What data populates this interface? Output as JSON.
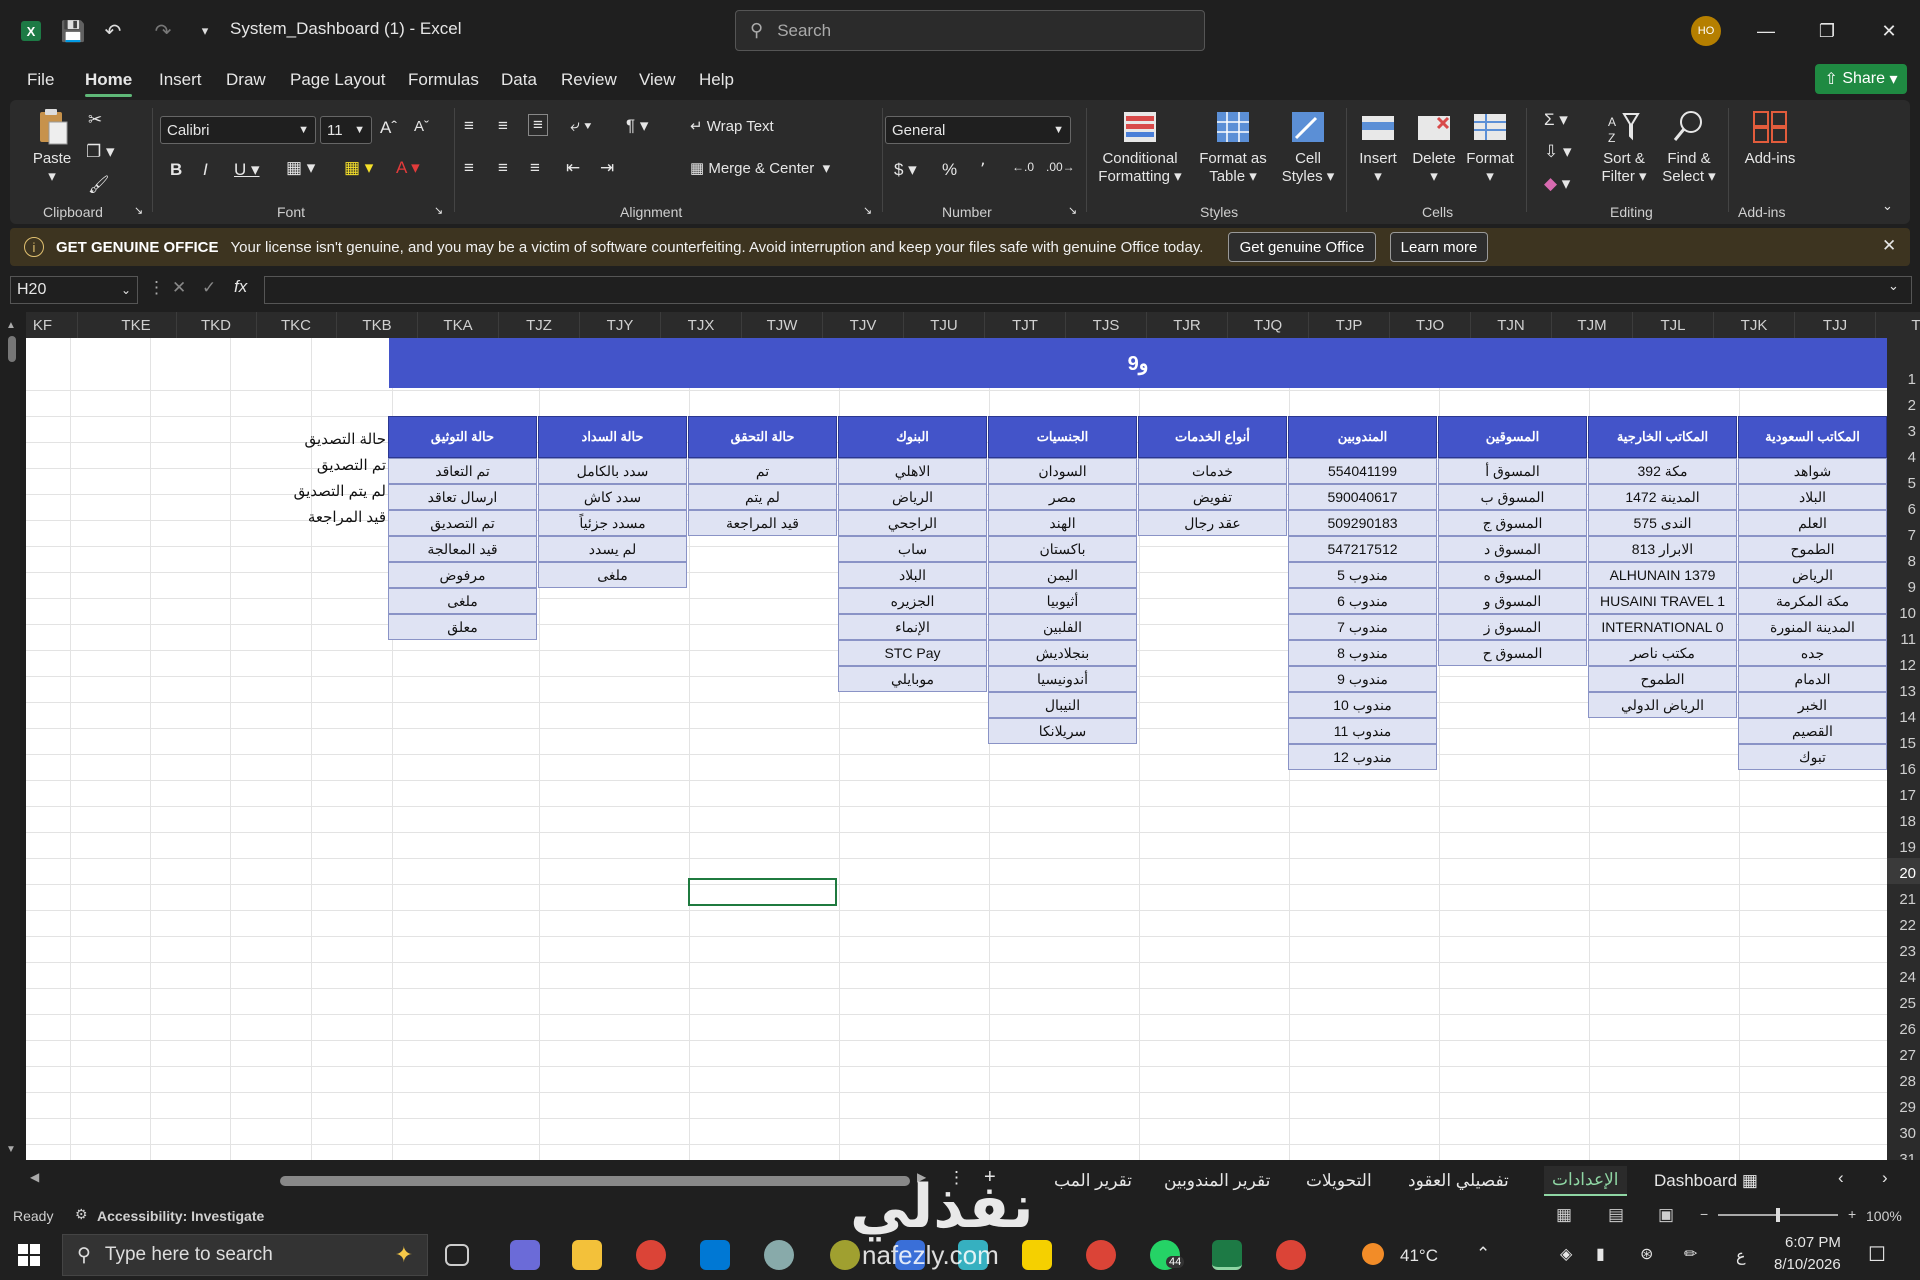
{
  "window": {
    "title": "System_Dashboard (1)  -  Excel",
    "search_placeholder": "Search",
    "avatar": "HO"
  },
  "menu": [
    "File",
    "Home",
    "Insert",
    "Draw",
    "Page Layout",
    "Formulas",
    "Data",
    "Review",
    "View",
    "Help"
  ],
  "share_label": "Share",
  "ribbon": {
    "clipboard": {
      "label": "Clipboard",
      "paste": "Paste"
    },
    "font": {
      "label": "Font",
      "name": "Calibri",
      "size": "11"
    },
    "alignment": {
      "label": "Alignment",
      "wrap": "Wrap Text",
      "merge": "Merge & Center"
    },
    "number": {
      "label": "Number",
      "format": "General"
    },
    "styles": {
      "label": "Styles",
      "conditional": "Conditional\nFormatting",
      "format_table": "Format as\nTable",
      "cell_styles": "Cell\nStyles"
    },
    "cells": {
      "label": "Cells",
      "insert": "Insert",
      "delete": "Delete",
      "format": "Format"
    },
    "editing": {
      "label": "Editing",
      "sort": "Sort &\nFilter",
      "find": "Find &\nSelect"
    },
    "addins": {
      "label": "Add-ins",
      "addins": "Add-ins"
    }
  },
  "warning": {
    "title": "GET GENUINE OFFICE",
    "message": "Your license isn't genuine, and you may be a victim of software counterfeiting. Avoid interruption and keep your files safe with genuine Office today.",
    "btn1": "Get genuine Office",
    "btn2": "Learn more"
  },
  "namebox": "H20",
  "columns": [
    "KF",
    "TKE",
    "TKD",
    "TKC",
    "TKB",
    "TKA",
    "TJZ",
    "TJY",
    "TJX",
    "TJW",
    "TJV",
    "TJU",
    "TJT",
    "TJS",
    "TJR",
    "TJQ",
    "TJP",
    "TJO",
    "TJN",
    "TJM",
    "TJL",
    "TJK",
    "TJJ",
    "T"
  ],
  "rows": [
    "1",
    "2",
    "3",
    "4",
    "5",
    "6",
    "7",
    "8",
    "9",
    "10",
    "11",
    "12",
    "13",
    "14",
    "15",
    "16",
    "17",
    "18",
    "19",
    "20",
    "21",
    "22",
    "23",
    "24",
    "25",
    "26",
    "27",
    "28",
    "29",
    "30",
    "31"
  ],
  "selected_row": "20",
  "sheet": {
    "banner": "و9",
    "side_labels": [
      "حالة التصديق",
      "تم التصديق",
      "لم يتم التصديق",
      "قيد المراجعة"
    ],
    "tables": [
      {
        "header": "المكاتب السعودية",
        "cells": [
          "شواهد",
          "البلاد",
          "العلم",
          "الطموح",
          "الرياض",
          "مكة المكرمة",
          "المدينة المنورة",
          "جده",
          "الدمام",
          "الخبر",
          "القصيم",
          "تبوك"
        ]
      },
      {
        "header": "المكاتب الخارجية",
        "cells": [
          "مكة 392",
          "المدينة 1472",
          "الندى 575",
          "الابرار 813",
          "ALHUNAIN 1379",
          "HUSAINI TRAVEL 1",
          "INTERNATIONAL 0",
          "مكتب ناصر",
          "الطموح",
          "الرياض الدولي"
        ]
      },
      {
        "header": "المسوقين",
        "cells": [
          "المسوق أ",
          "المسوق ب",
          "المسوق ج",
          "المسوق د",
          "المسوق ه",
          "المسوق و",
          "المسوق ز",
          "المسوق ح"
        ]
      },
      {
        "header": "المندوبين",
        "cells": [
          "554041199",
          "590040617",
          "509290183",
          "547217512",
          "مندوب 5",
          "مندوب 6",
          "مندوب 7",
          "مندوب 8",
          "مندوب 9",
          "مندوب 10",
          "مندوب 11",
          "مندوب 12"
        ]
      },
      {
        "header": "أنواع الخدمات",
        "cells": [
          "خدمات",
          "تفويض",
          "عقد رجال"
        ]
      },
      {
        "header": "الجنسيات",
        "cells": [
          "السودان",
          "مصر",
          "الهند",
          "باكستان",
          "اليمن",
          "أثيوبيا",
          "الفلبين",
          "بنجلاديش",
          "أندونيسيا",
          "النيبال",
          "سريلانكا"
        ]
      },
      {
        "header": "البنوك",
        "cells": [
          "الاهلي",
          "الرياض",
          "الراجحي",
          "ساب",
          "البلاد",
          "الجزيره",
          "الإنماء",
          "STC Pay",
          "موبايلي"
        ]
      },
      {
        "header": "حالة التحقق",
        "cells": [
          "تم",
          "لم يتم",
          "قيد المراجعة"
        ]
      },
      {
        "header": "حالة السداد",
        "cells": [
          "سدد بالكامل",
          "سدد كاش",
          "مسدد جزئياً",
          "لم يسدد",
          "ملغى"
        ]
      },
      {
        "header": "حالة التوثيق",
        "cells": [
          "تم التعاقد",
          "ارسال تعاقد",
          "تم التصديق",
          "قيد المعالجة",
          "مرفوض",
          "ملغى",
          "معلق"
        ]
      }
    ]
  },
  "tabs": [
    "Dashboard",
    "الإعدادات",
    "تفصيلي العقود",
    "التحويلات",
    "تقرير المندوبين",
    "تقرير المب"
  ],
  "active_tab": "الإعدادات",
  "status": {
    "ready": "Ready",
    "accessibility": "Accessibility: Investigate",
    "zoom": "100%"
  },
  "taskbar": {
    "search": "Type here to search",
    "temp": "41°C",
    "time": "6:07 PM",
    "date": "8/10/2026",
    "badge": "44",
    "lang": "ع"
  },
  "watermark": {
    "ar": "نفذلي",
    "en": "nafezly.com"
  },
  "colors": {
    "header_blue": "#4354c9",
    "cell_fill": "#dfe3f3",
    "excel_green": "#1f8a42"
  }
}
